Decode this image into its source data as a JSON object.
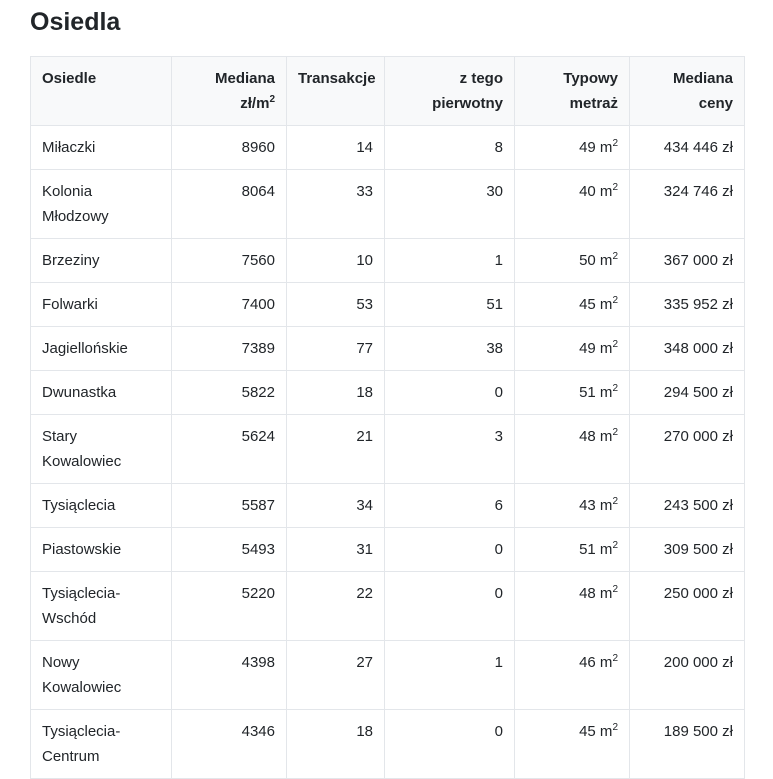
{
  "title": "Osiedla",
  "headers": {
    "osiedle": "Osiedle",
    "mediana_m2_main": "Mediana",
    "mediana_m2_unit": "zł/m",
    "mediana_m2_sup": "2",
    "transakcje": "Transakcje",
    "pierwotny_1": "z tego",
    "pierwotny_2": "pierwotny",
    "metraz_1": "Typowy",
    "metraz_2": "metraż",
    "cena_1": "Mediana",
    "cena_2": "ceny"
  },
  "unit_sup": "2",
  "rows": [
    {
      "name": "Miłaczki",
      "median_m2": "8960",
      "transactions": "14",
      "primary": "8",
      "area": "49 m",
      "price": "434 446 zł"
    },
    {
      "name": "Kolonia Młodzowy",
      "median_m2": "8064",
      "transactions": "33",
      "primary": "30",
      "area": "40 m",
      "price": "324 746 zł"
    },
    {
      "name": "Brzeziny",
      "median_m2": "7560",
      "transactions": "10",
      "primary": "1",
      "area": "50 m",
      "price": "367 000 zł"
    },
    {
      "name": "Folwarki",
      "median_m2": "7400",
      "transactions": "53",
      "primary": "51",
      "area": "45 m",
      "price": "335 952 zł"
    },
    {
      "name": "Jagiellońskie",
      "median_m2": "7389",
      "transactions": "77",
      "primary": "38",
      "area": "49 m",
      "price": "348 000 zł"
    },
    {
      "name": "Dwunastka",
      "median_m2": "5822",
      "transactions": "18",
      "primary": "0",
      "area": "51 m",
      "price": "294 500 zł"
    },
    {
      "name": "Stary Kowalowiec",
      "median_m2": "5624",
      "transactions": "21",
      "primary": "3",
      "area": "48 m",
      "price": "270 000 zł"
    },
    {
      "name": "Tysiąclecia",
      "median_m2": "5587",
      "transactions": "34",
      "primary": "6",
      "area": "43 m",
      "price": "243 500 zł"
    },
    {
      "name": "Piastowskie",
      "median_m2": "5493",
      "transactions": "31",
      "primary": "0",
      "area": "51 m",
      "price": "309 500 zł"
    },
    {
      "name": "Tysiąclecia-Wschód",
      "median_m2": "5220",
      "transactions": "22",
      "primary": "0",
      "area": "48 m",
      "price": "250 000 zł"
    },
    {
      "name": "Nowy Kowalowiec",
      "median_m2": "4398",
      "transactions": "27",
      "primary": "1",
      "area": "46 m",
      "price": "200 000 zł"
    },
    {
      "name": "Tysiąclecia-Centrum",
      "median_m2": "4346",
      "transactions": "18",
      "primary": "0",
      "area": "45 m",
      "price": "189 500 zł"
    }
  ]
}
